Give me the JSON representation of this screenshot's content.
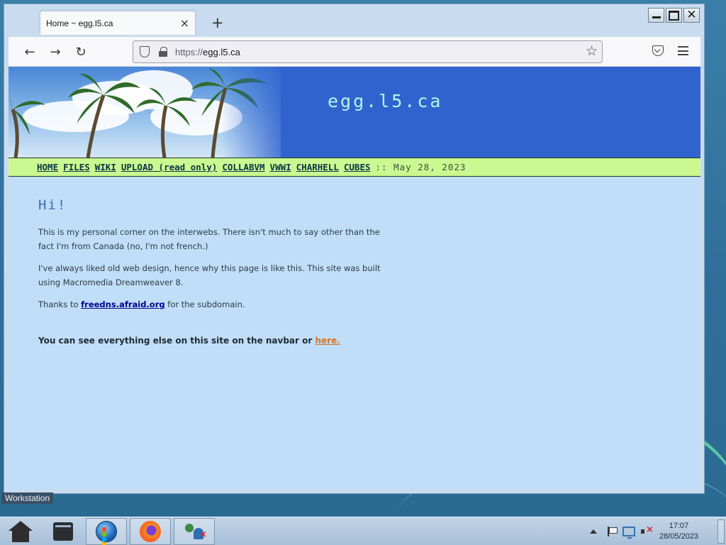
{
  "browser": {
    "tab_title": "Home ~ egg.l5.ca",
    "tab_close_glyph": "×",
    "new_tab_glyph": "+",
    "url_prefix": "https://",
    "url_host": "egg.l5.ca",
    "back_glyph": "←",
    "forward_glyph": "→",
    "reload_glyph": "↻",
    "bookmark_glyph": "☆"
  },
  "page": {
    "site_title": "egg.l5.ca",
    "nav_links": [
      "HOME",
      "FILES",
      "WIKI",
      "UPLOAD (read only)",
      "COLLABVM",
      "VWWI",
      "CHARHELL",
      "CUBES"
    ],
    "date_text": ":: May 28, 2023",
    "heading": "Hi!",
    "para1": "This is my personal corner on the interwebs. There isn't much to say other than the fact I'm from Canada (no, I'm not french.)",
    "para2": "I've always liked old web design, hence why this page is like this. This site was built using Macromedia Dreamweaver 8.",
    "para3_prefix": "Thanks to ",
    "para3_link": "freedns.afraid.org",
    "para3_suffix": " for the subdomain.",
    "para4_text": "You can see everything else on this site on the navbar or ",
    "para4_link": "here."
  },
  "desktop": {
    "workstation_label": "Workstation"
  },
  "taskbar": {
    "time": "17:07",
    "date": "28/05/2023"
  },
  "colors": {
    "page_bg": "#c0def8",
    "banner_blue": "#3163cf",
    "nav_strip": "#caf991",
    "heading": "#3e6bb3",
    "link_orange": "#d97324"
  }
}
